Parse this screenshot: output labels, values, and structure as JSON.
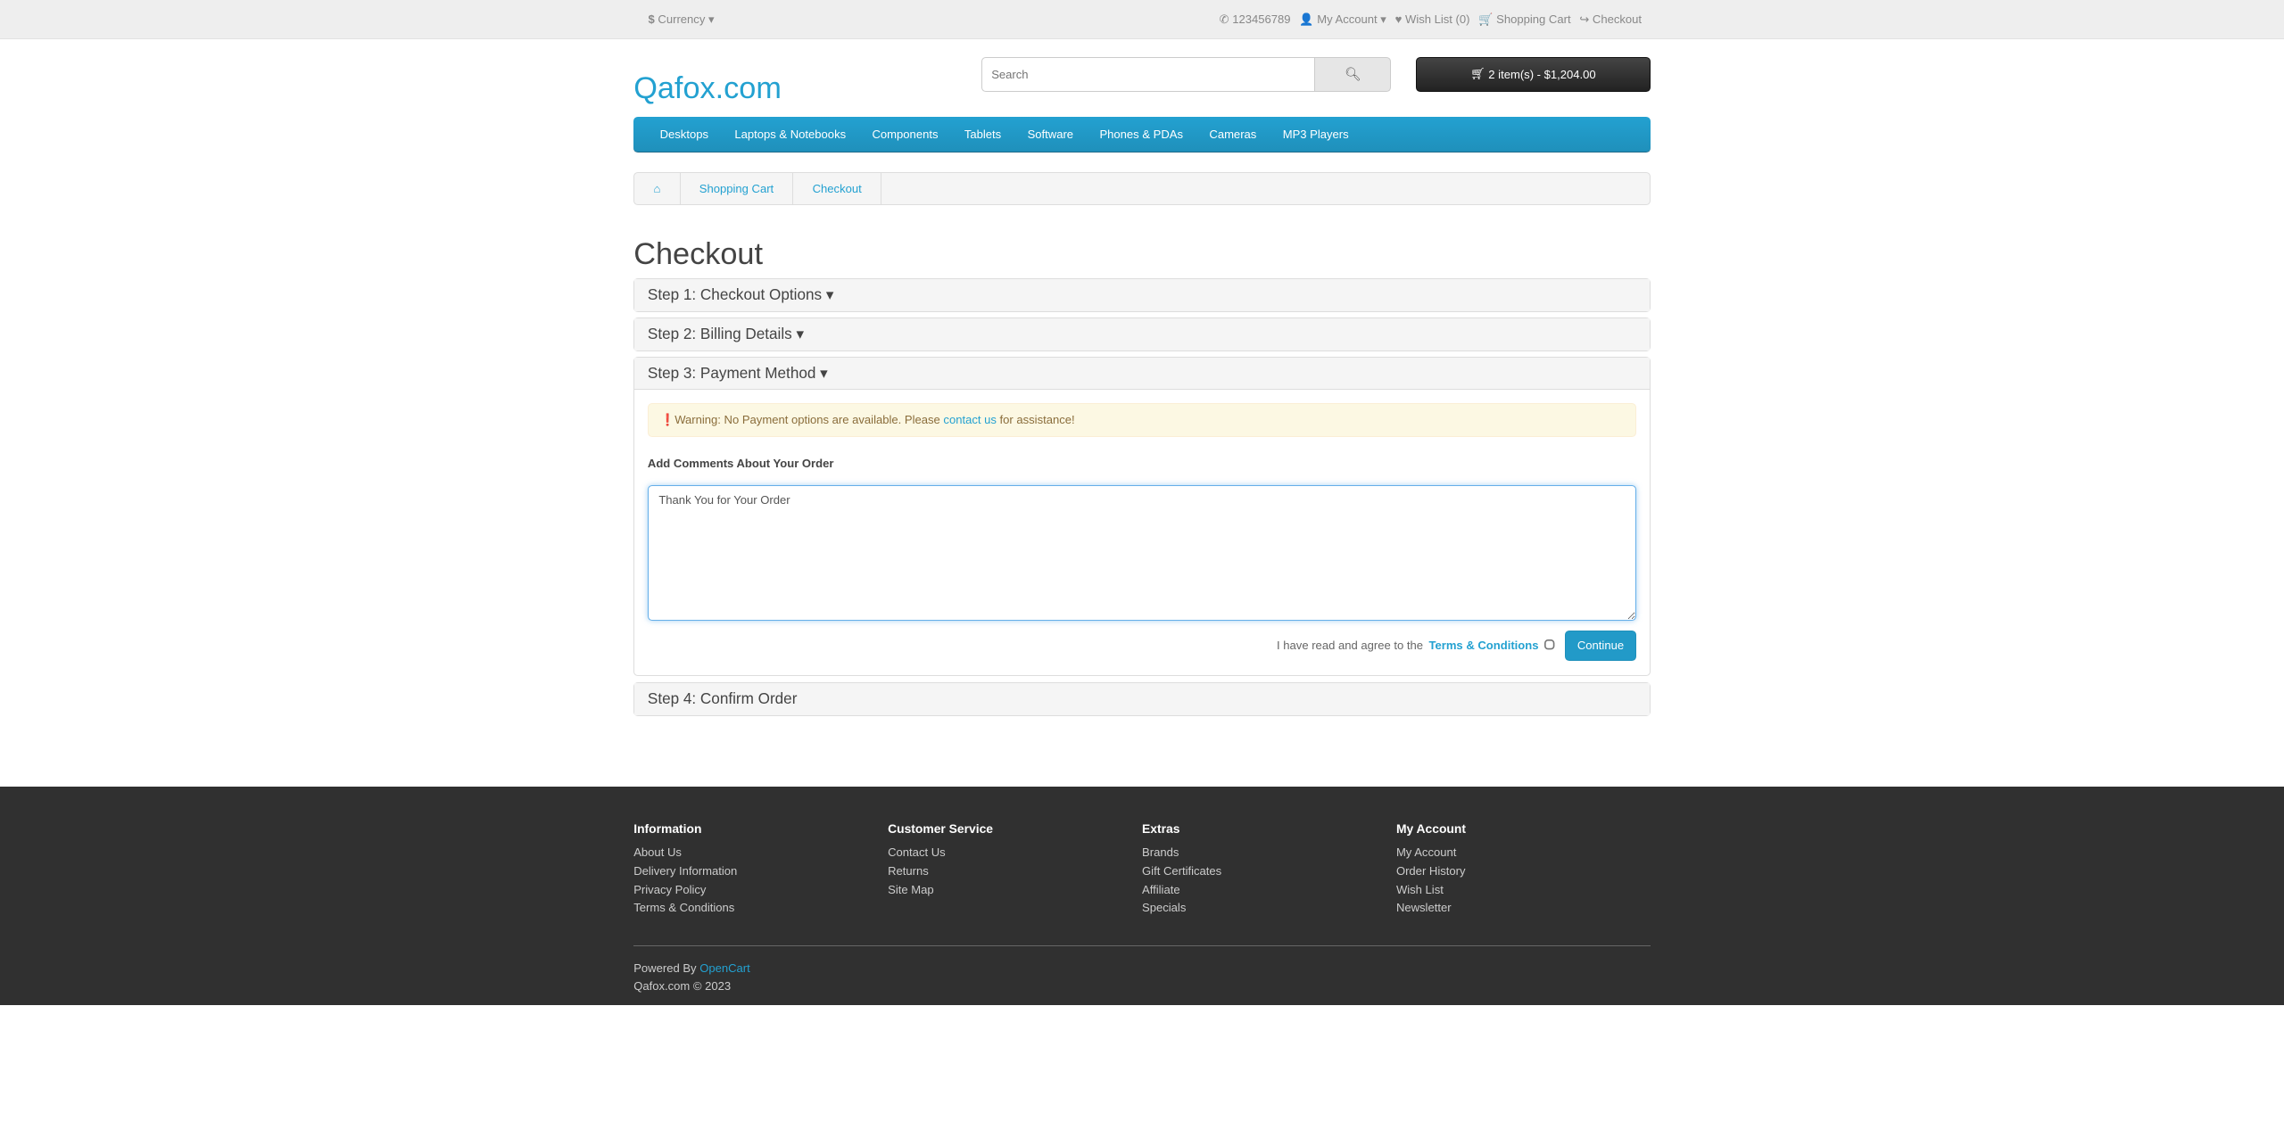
{
  "topbar": {
    "currency": "Currency",
    "phone": "123456789",
    "my_account": "My Account",
    "wish_list": "Wish List (0)",
    "shopping_cart": "Shopping Cart",
    "checkout": "Checkout"
  },
  "header": {
    "logo": "Qafox.com",
    "search_placeholder": "Search",
    "cart": "2 item(s) - $1,204.00"
  },
  "nav": [
    "Desktops",
    "Laptops & Notebooks",
    "Components",
    "Tablets",
    "Software",
    "Phones & PDAs",
    "Cameras",
    "MP3 Players"
  ],
  "breadcrumb": [
    "Shopping Cart",
    "Checkout"
  ],
  "page_title": "Checkout",
  "steps": [
    "Step 1: Checkout Options",
    "Step 2: Billing Details",
    "Step 3: Payment Method",
    "Step 4: Confirm Order"
  ],
  "payment": {
    "warning_before": "Warning: No Payment options are available. Please ",
    "warning_link": "contact us",
    "warning_after": " for assistance!",
    "comments_label": "Add Comments About Your Order",
    "comments_value": "Thank You for Your Order",
    "agree_text": "I have read and agree to the ",
    "terms_link": "Terms & Conditions",
    "continue": "Continue"
  },
  "footer": {
    "columns": [
      {
        "title": "Information",
        "links": [
          "About Us",
          "Delivery Information",
          "Privacy Policy",
          "Terms & Conditions"
        ]
      },
      {
        "title": "Customer Service",
        "links": [
          "Contact Us",
          "Returns",
          "Site Map"
        ]
      },
      {
        "title": "Extras",
        "links": [
          "Brands",
          "Gift Certificates",
          "Affiliate",
          "Specials"
        ]
      },
      {
        "title": "My Account",
        "links": [
          "My Account",
          "Order History",
          "Wish List",
          "Newsletter"
        ]
      }
    ],
    "powered_prefix": "Powered By ",
    "powered_link": "OpenCart",
    "copyright": "Qafox.com © 2023"
  },
  "colors": {
    "accent": "#23a1d1",
    "footer_bg": "#303030",
    "warning_bg": "#fcf8e3"
  }
}
